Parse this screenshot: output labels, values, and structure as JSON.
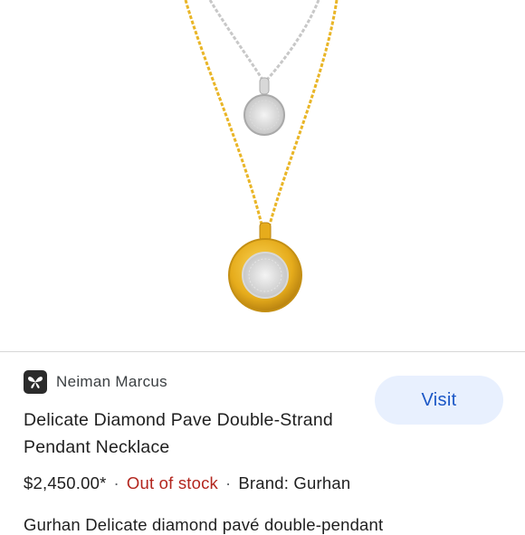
{
  "product_image": {
    "alt": ""
  },
  "source": {
    "name": "Neiman Marcus",
    "logo_icon": "butterfly-icon"
  },
  "listing": {
    "title": "Delicate Diamond Pave Double-Strand Pendant Necklace",
    "price": "$2,450.00*",
    "separator": "·",
    "stock_status": "Out of stock",
    "brand": "Brand: Gurhan",
    "description_partial": "Gurhan Delicate diamond pavé double-pendant"
  },
  "visit_button": {
    "label": "Visit"
  },
  "colors": {
    "accent": "#1a56c6",
    "button_bg": "#e8f0fe",
    "out_of_stock": "#b3261e",
    "gold": "#e7b321",
    "silver": "#c9c9c9"
  }
}
